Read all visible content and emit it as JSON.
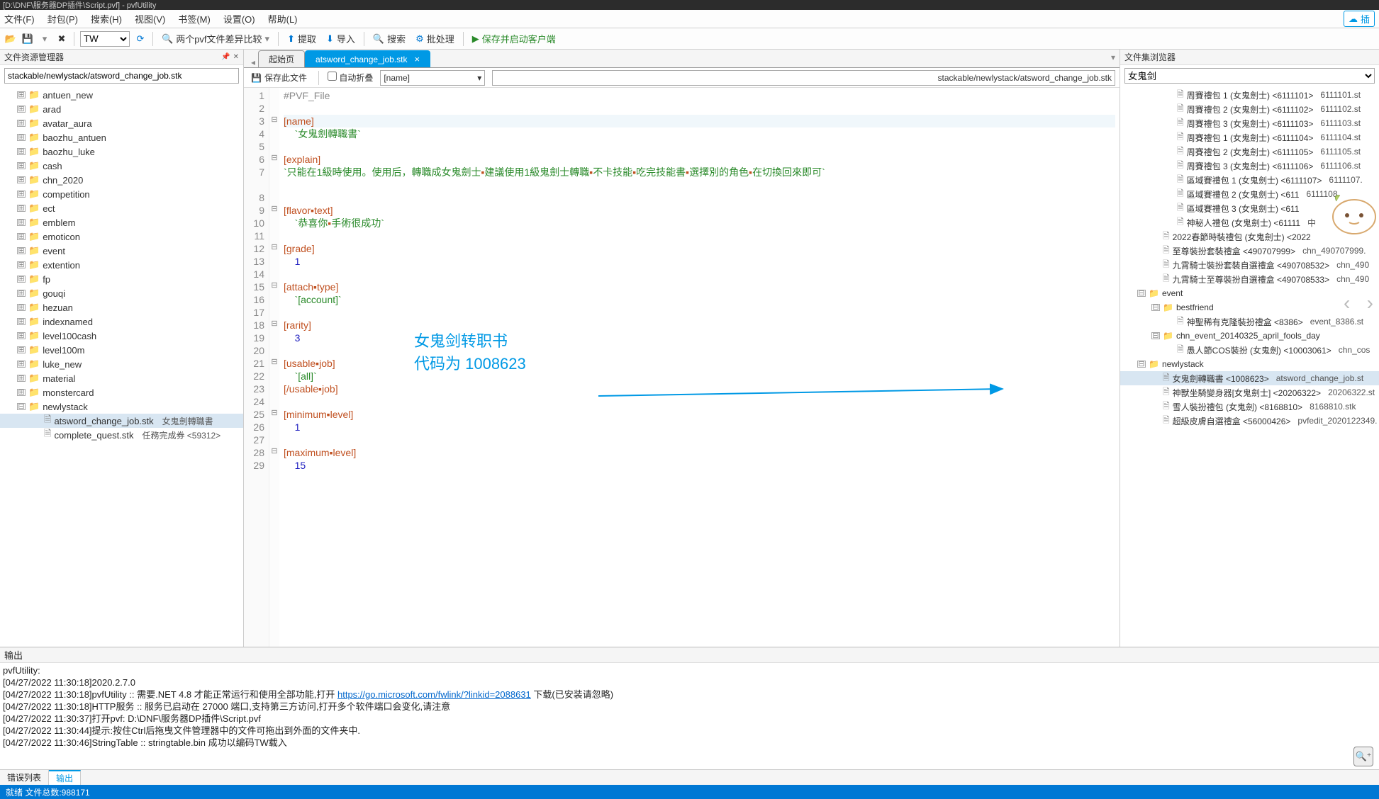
{
  "window": {
    "title": "[D:\\DNF\\服务器DP插件\\Script.pvf] - pvfUtility"
  },
  "menu": {
    "file": "文件(F)",
    "fengbao": "封包(P)",
    "search": "搜索(H)",
    "view": "视图(V)",
    "bookmark": "书签(M)",
    "settings": "设置(O)",
    "help": "帮助(L)",
    "cloud": "插"
  },
  "toolbar": {
    "region_selected": "TW",
    "diff": "两个pvf文件差异比较",
    "extract": "提取",
    "import": "导入",
    "search": "搜索",
    "batch": "批处理",
    "save_launch": "保存并启动客户端"
  },
  "left_panel": {
    "title": "文件资源管理器",
    "path": "stackable/newlystack/atsword_change_job.stk",
    "folders": [
      "antuen_new",
      "arad",
      "avatar_aura",
      "baozhu_antuen",
      "baozhu_luke",
      "cash",
      "chn_2020",
      "competition",
      "ect",
      "emblem",
      "emoticon",
      "event",
      "extention",
      "fp",
      "gouqi",
      "hezuan",
      "indexnamed",
      "level100cash",
      "level100m",
      "luke_new",
      "material",
      "monstercard",
      "newlystack"
    ],
    "files": [
      {
        "name": "atsword_change_job.stk",
        "meta": "女鬼劍轉職書",
        "selected": true
      },
      {
        "name": "complete_quest.stk",
        "meta": "任務完成券 <59312>"
      }
    ]
  },
  "tabs": {
    "start": "起始页",
    "active": "atsword_change_job.stk"
  },
  "editor_toolbar": {
    "save": "保存此文件",
    "autofold": "自动折叠",
    "dropdown": "[name]",
    "path": "stackable/newlystack/atsword_change_job.stk"
  },
  "code": {
    "lines": [
      {
        "n": 1,
        "fold": "",
        "body": [
          [
            "dir",
            "#PVF_File"
          ]
        ]
      },
      {
        "n": 2,
        "fold": "",
        "body": [
          [
            "",
            ""
          ]
        ]
      },
      {
        "n": 3,
        "fold": "-",
        "hl": true,
        "body": [
          [
            "tag",
            "[name]"
          ]
        ]
      },
      {
        "n": 4,
        "fold": "",
        "body": [
          [
            "",
            "    "
          ],
          [
            "str",
            "`女鬼劍轉職書`"
          ]
        ]
      },
      {
        "n": 5,
        "fold": "",
        "body": [
          [
            "",
            ""
          ]
        ]
      },
      {
        "n": 6,
        "fold": "-",
        "body": [
          [
            "tag",
            "[explain]"
          ]
        ]
      },
      {
        "n": 7,
        "fold": "",
        "wrap": true,
        "body": [
          [
            "",
            "    "
          ],
          [
            "str",
            "`只能在1級時使用。使用后，轉職成女鬼劍士"
          ],
          [
            "dot",
            "▪"
          ],
          [
            "str",
            "建議使用1級鬼劍士轉職"
          ],
          [
            "dot",
            "▪"
          ],
          [
            "str",
            "不卡技能"
          ],
          [
            "dot",
            "▪"
          ],
          [
            "str",
            "吃完技能書"
          ],
          [
            "dot",
            "▪"
          ],
          [
            "str",
            "選擇別的角色"
          ],
          [
            "dot",
            "▪"
          ],
          [
            "str",
            "在切換回來即可`"
          ]
        ]
      },
      {
        "n": 8,
        "fold": "",
        "body": [
          [
            "",
            ""
          ]
        ]
      },
      {
        "n": 9,
        "fold": "-",
        "body": [
          [
            "tag",
            "[flavor"
          ],
          [
            "dot",
            "▪"
          ],
          [
            "tag",
            "text]"
          ]
        ]
      },
      {
        "n": 10,
        "fold": "",
        "body": [
          [
            "",
            "    "
          ],
          [
            "str",
            "`恭喜你"
          ],
          [
            "dot",
            "▪"
          ],
          [
            "str",
            "手術很成功`"
          ]
        ]
      },
      {
        "n": 11,
        "fold": "",
        "body": [
          [
            "",
            ""
          ]
        ]
      },
      {
        "n": 12,
        "fold": "-",
        "body": [
          [
            "tag",
            "[grade]"
          ]
        ]
      },
      {
        "n": 13,
        "fold": "",
        "body": [
          [
            "",
            "    "
          ],
          [
            "num",
            "1"
          ]
        ]
      },
      {
        "n": 14,
        "fold": "",
        "body": [
          [
            "",
            ""
          ]
        ]
      },
      {
        "n": 15,
        "fold": "-",
        "body": [
          [
            "tag",
            "[attach"
          ],
          [
            "dot",
            "▪"
          ],
          [
            "tag",
            "type]"
          ]
        ]
      },
      {
        "n": 16,
        "fold": "",
        "body": [
          [
            "",
            "    "
          ],
          [
            "str",
            "`[account]`"
          ]
        ]
      },
      {
        "n": 17,
        "fold": "",
        "body": [
          [
            "",
            ""
          ]
        ]
      },
      {
        "n": 18,
        "fold": "-",
        "body": [
          [
            "tag",
            "[rarity]"
          ]
        ]
      },
      {
        "n": 19,
        "fold": "",
        "body": [
          [
            "",
            "    "
          ],
          [
            "num",
            "3"
          ]
        ]
      },
      {
        "n": 20,
        "fold": "",
        "body": [
          [
            "",
            ""
          ]
        ]
      },
      {
        "n": 21,
        "fold": "-",
        "body": [
          [
            "tag",
            "[usable"
          ],
          [
            "dot",
            "▪"
          ],
          [
            "tag",
            "job]"
          ]
        ]
      },
      {
        "n": 22,
        "fold": "",
        "body": [
          [
            "",
            "    "
          ],
          [
            "str",
            "`[all]`"
          ]
        ]
      },
      {
        "n": 23,
        "fold": "",
        "body": [
          [
            "close",
            "[/usable"
          ],
          [
            "dot",
            "▪"
          ],
          [
            "close",
            "job]"
          ]
        ]
      },
      {
        "n": 24,
        "fold": "",
        "body": [
          [
            "",
            ""
          ]
        ]
      },
      {
        "n": 25,
        "fold": "-",
        "body": [
          [
            "tag",
            "[minimum"
          ],
          [
            "dot",
            "▪"
          ],
          [
            "tag",
            "level]"
          ]
        ]
      },
      {
        "n": 26,
        "fold": "",
        "body": [
          [
            "",
            "    "
          ],
          [
            "num",
            "1"
          ]
        ]
      },
      {
        "n": 27,
        "fold": "",
        "body": [
          [
            "",
            ""
          ]
        ]
      },
      {
        "n": 28,
        "fold": "-",
        "body": [
          [
            "tag",
            "[maximum"
          ],
          [
            "dot",
            "▪"
          ],
          [
            "tag",
            "level]"
          ]
        ]
      },
      {
        "n": 29,
        "fold": "",
        "body": [
          [
            "",
            "    "
          ],
          [
            "num",
            "15"
          ]
        ]
      }
    ]
  },
  "annotation": {
    "line1": "女鬼剑转职书",
    "line2": "代码为 1008623"
  },
  "right_panel": {
    "title": "文件集浏览器",
    "filter": "女鬼剑",
    "items": [
      {
        "d": 3,
        "ico": "file",
        "nm": "周賽禮包 1 (女鬼劍士) <6111101>",
        "fn": "6111101.st"
      },
      {
        "d": 3,
        "ico": "file",
        "nm": "周賽禮包 2 (女鬼劍士) <6111102>",
        "fn": "6111102.st"
      },
      {
        "d": 3,
        "ico": "file",
        "nm": "周賽禮包 3 (女鬼劍士) <6111103>",
        "fn": "6111103.st"
      },
      {
        "d": 3,
        "ico": "file",
        "nm": "周賽禮包 1 (女鬼劍士) <6111104>",
        "fn": "6111104.st"
      },
      {
        "d": 3,
        "ico": "file",
        "nm": "周賽禮包 2 (女鬼劍士) <6111105>",
        "fn": "6111105.st"
      },
      {
        "d": 3,
        "ico": "file",
        "nm": "周賽禮包 3 (女鬼劍士) <6111106>",
        "fn": "6111106.st"
      },
      {
        "d": 3,
        "ico": "file",
        "nm": "區域賽禮包 1 (女鬼劍士) <6111107>",
        "fn": "6111107."
      },
      {
        "d": 3,
        "ico": "file",
        "nm": "區域賽禮包 2 (女鬼劍士) <611",
        "fn": "6111108."
      },
      {
        "d": 3,
        "ico": "file",
        "nm": "區域賽禮包 3 (女鬼劍士) <611",
        "fn": ""
      },
      {
        "d": 3,
        "ico": "file",
        "nm": "神秘人禮包 (女鬼劍士) <61111",
        "fn": "中"
      },
      {
        "d": 2,
        "ico": "file",
        "nm": "2022春節時裝禮包 (女鬼劍士) <2022",
        "fn": ""
      },
      {
        "d": 2,
        "ico": "file",
        "nm": "至尊裝扮套裝禮盒 <490707999>",
        "fn": "chn_490707999."
      },
      {
        "d": 2,
        "ico": "file",
        "nm": "九霄騎士裝扮套裝自選禮盒 <490708532>",
        "fn": "chn_490"
      },
      {
        "d": 2,
        "ico": "file",
        "nm": "九霄騎士至尊裝扮自選禮盒 <490708533>",
        "fn": "chn_490"
      },
      {
        "d": 1,
        "ico": "folder",
        "tog": "-",
        "nm": "event",
        "fn": ""
      },
      {
        "d": 2,
        "ico": "folder",
        "tog": "-",
        "nm": "bestfriend",
        "fn": ""
      },
      {
        "d": 3,
        "ico": "file",
        "nm": "神聖稀有克隆裝扮禮盒 <8386>",
        "fn": "event_8386.st"
      },
      {
        "d": 2,
        "ico": "folder",
        "tog": "-",
        "nm": "chn_event_20140325_april_fools_day",
        "fn": ""
      },
      {
        "d": 3,
        "ico": "file",
        "nm": "愚人節COS裝扮 (女鬼劍) <10003061>",
        "fn": "chn_cos"
      },
      {
        "d": 1,
        "ico": "folder",
        "tog": "-",
        "nm": "newlystack",
        "fn": ""
      },
      {
        "d": 2,
        "ico": "file",
        "sel": true,
        "nm": "女鬼劍轉職書 <1008623>",
        "fn": "atsword_change_job.st"
      },
      {
        "d": 2,
        "ico": "file",
        "nm": "神獸坐騎變身器[女鬼劍士] <20206322>",
        "fn": "20206322.st"
      },
      {
        "d": 2,
        "ico": "file",
        "nm": "雪人裝扮禮包 (女鬼劍) <8168810>",
        "fn": "8168810.stk"
      },
      {
        "d": 2,
        "ico": "file",
        "nm": "超級皮膚自選禮盒 <56000426>",
        "fn": "pvfedit_2020122349."
      }
    ]
  },
  "output": {
    "title": "输出",
    "lines": [
      "pvfUtility:",
      "[04/27/2022 11:30:18]2020.2.7.0",
      {
        "pre": "[04/27/2022 11:30:18]pvfUtility :: 需要.NET 4.8 才能正常运行和使用全部功能,打开 ",
        "link": "https://go.microsoft.com/fwlink/?linkid=2088631",
        "post": " 下载(已安装请忽略)"
      },
      "[04/27/2022 11:30:18]HTTP服务 :: 服务已启动在 27000 端口,支持第三方访问,打开多个软件端口会变化,请注意",
      "[04/27/2022 11:30:37]打开pvf: D:\\DNF\\服务器DP插件\\Script.pvf",
      "[04/27/2022 11:30:44]提示:按住Ctrl后拖曳文件管理器中的文件可拖出到外面的文件夹中.",
      "[04/27/2022 11:30:46]StringTable :: stringtable.bin 成功以编码TW载入"
    ],
    "tabs": {
      "errors": "错误列表",
      "output": "输出"
    }
  },
  "statusbar": {
    "text": "就绪 文件总数:988171"
  }
}
